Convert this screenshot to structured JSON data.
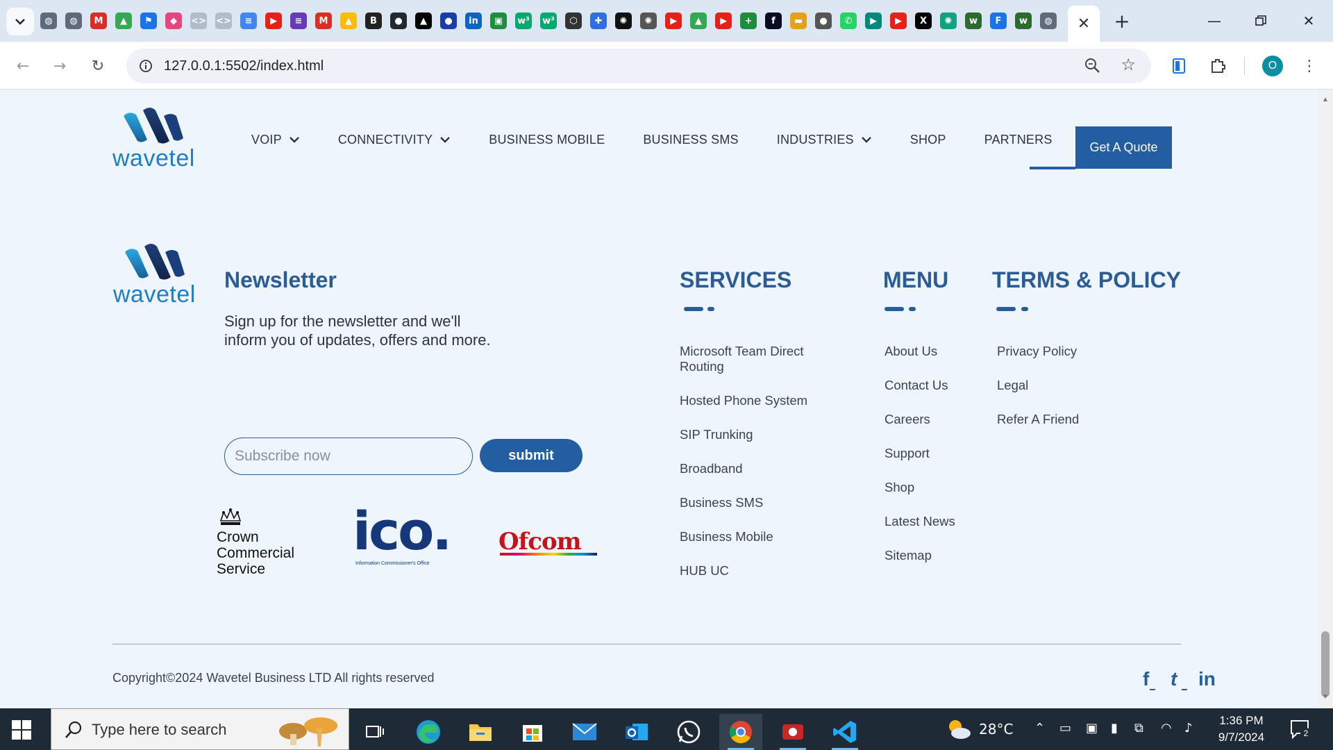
{
  "browser": {
    "url": "127.0.0.1:5502/index.html",
    "profile_initial": "O",
    "tab_favicons": [
      {
        "name": "globe-icon",
        "glyph": "◍",
        "bg": "#5f6b7a"
      },
      {
        "name": "globe-icon",
        "glyph": "◍",
        "bg": "#5f6b7a"
      },
      {
        "name": "gmail-icon",
        "glyph": "M",
        "bg": "#d93025"
      },
      {
        "name": "drive-icon",
        "glyph": "▲",
        "bg": "#34a853"
      },
      {
        "name": "flag-icon",
        "glyph": "⚑",
        "bg": "#1a73e8"
      },
      {
        "name": "cube-icon",
        "glyph": "◆",
        "bg": "#e8457d"
      },
      {
        "name": "code-icon",
        "glyph": "<>",
        "bg": "#b0bcc9"
      },
      {
        "name": "code-icon",
        "glyph": "<>",
        "bg": "#b0bcc9"
      },
      {
        "name": "docs-icon",
        "glyph": "≡",
        "bg": "#4285f4"
      },
      {
        "name": "youtube-icon",
        "glyph": "▶",
        "bg": "#e62117"
      },
      {
        "name": "forms-icon",
        "glyph": "≡",
        "bg": "#673ab7"
      },
      {
        "name": "gmail-icon",
        "glyph": "M",
        "bg": "#d93025"
      },
      {
        "name": "drive-icon",
        "glyph": "▲",
        "bg": "#fbbc04"
      },
      {
        "name": "bold-icon",
        "glyph": "B",
        "bg": "#222222"
      },
      {
        "name": "github-icon",
        "glyph": "●",
        "bg": "#24292f"
      },
      {
        "name": "vercel-icon",
        "glyph": "▲",
        "bg": "#000000"
      },
      {
        "name": "dot-icon",
        "glyph": "●",
        "bg": "#1a3ea8"
      },
      {
        "name": "linkedin-icon",
        "glyph": "in",
        "bg": "#0a66c2"
      },
      {
        "name": "image-icon",
        "glyph": "▣",
        "bg": "#1e8e3e"
      },
      {
        "name": "w3schools-icon",
        "glyph": "w³",
        "bg": "#04aa6d"
      },
      {
        "name": "w3schools-icon",
        "glyph": "w³",
        "bg": "#04aa6d"
      },
      {
        "name": "codepen-icon",
        "glyph": "⬡",
        "bg": "#333333"
      },
      {
        "name": "puzzle-icon",
        "glyph": "✚",
        "bg": "#2f6fe0"
      },
      {
        "name": "chatgpt-icon",
        "glyph": "✺",
        "bg": "#111111"
      },
      {
        "name": "chatgpt-icon",
        "glyph": "✺",
        "bg": "#555555"
      },
      {
        "name": "youtube-icon",
        "glyph": "▶",
        "bg": "#e62117"
      },
      {
        "name": "drive-icon",
        "glyph": "▲",
        "bg": "#34a853"
      },
      {
        "name": "youtube-icon",
        "glyph": "▶",
        "bg": "#e62117"
      },
      {
        "name": "plus-box-icon",
        "glyph": "+",
        "bg": "#1e8e3e"
      },
      {
        "name": "freecodecamp-icon",
        "glyph": "f",
        "bg": "#0a0a23"
      },
      {
        "name": "graduation-icon",
        "glyph": "▬",
        "bg": "#e3a21a"
      },
      {
        "name": "avatar-icon",
        "glyph": "●",
        "bg": "#555555"
      },
      {
        "name": "whatsapp-icon",
        "glyph": "✆",
        "bg": "#25d366"
      },
      {
        "name": "meet-icon",
        "glyph": "▶",
        "bg": "#00897b"
      },
      {
        "name": "youtube-icon",
        "glyph": "▶",
        "bg": "#e62117"
      },
      {
        "name": "x-icon",
        "glyph": "X",
        "bg": "#000000"
      },
      {
        "name": "openai-icon",
        "glyph": "✺",
        "bg": "#10a37f"
      },
      {
        "name": "w-icon",
        "glyph": "w",
        "bg": "#2d6a2f"
      },
      {
        "name": "forms-icon",
        "glyph": "F",
        "bg": "#1a73e8"
      },
      {
        "name": "w-icon",
        "glyph": "w",
        "bg": "#2d6a2f"
      },
      {
        "name": "globe-icon",
        "glyph": "◍",
        "bg": "#5f6b7a"
      }
    ]
  },
  "site": {
    "logo_text": "wavetel",
    "nav": {
      "items": [
        {
          "label": "VOIP",
          "dropdown": true
        },
        {
          "label": "CONNECTIVITY",
          "dropdown": true
        },
        {
          "label": "BUSINESS MOBILE",
          "dropdown": false
        },
        {
          "label": "BUSINESS SMS",
          "dropdown": false
        },
        {
          "label": "INDUSTRIES",
          "dropdown": true
        },
        {
          "label": "SHOP",
          "dropdown": false
        },
        {
          "label": "PARTNERS",
          "dropdown": false
        }
      ],
      "quote_label": "Get A Quote"
    },
    "newsletter": {
      "title": "Newsletter",
      "description": "Sign up for the newsletter and we'll inform you of updates, offers and more.",
      "placeholder": "Subscribe now",
      "submit_label": "submit"
    },
    "accreditations": {
      "ccs": [
        "Crown",
        "Commercial",
        "Service"
      ],
      "ico": "ico.",
      "ico_sub": "Information Commissioner's Office",
      "ofcom": "Ofcom"
    },
    "services": {
      "title": "SERVICES",
      "links": [
        "Microsoft Team Direct Routing",
        "Hosted Phone System",
        "SIP Trunking",
        "Broadband",
        "Business SMS",
        "Business Mobile",
        "HUB UC"
      ]
    },
    "menu": {
      "title": "MENU",
      "links": [
        "About Us",
        "Contact Us",
        "Careers",
        "Support",
        "Shop",
        "Latest News",
        "Sitemap"
      ]
    },
    "terms": {
      "title": "TERMS & POLICY",
      "links": [
        "Privacy Policy",
        "Legal",
        "Refer A Friend"
      ]
    },
    "copyright": "Copyright©2024 Wavetel Business LTD All rights reserved",
    "social": [
      "f",
      "t",
      "in"
    ]
  },
  "taskbar": {
    "search_placeholder": "Type here to search",
    "weather": "28°C",
    "time": "1:36 PM",
    "date": "9/7/2024",
    "notification_count": "2"
  },
  "colors": {
    "brand_blue": "#235ea3",
    "heading_blue": "#2b5c93",
    "logo_blue": "#1f7fc4",
    "page_bg": "#eef5fc"
  }
}
